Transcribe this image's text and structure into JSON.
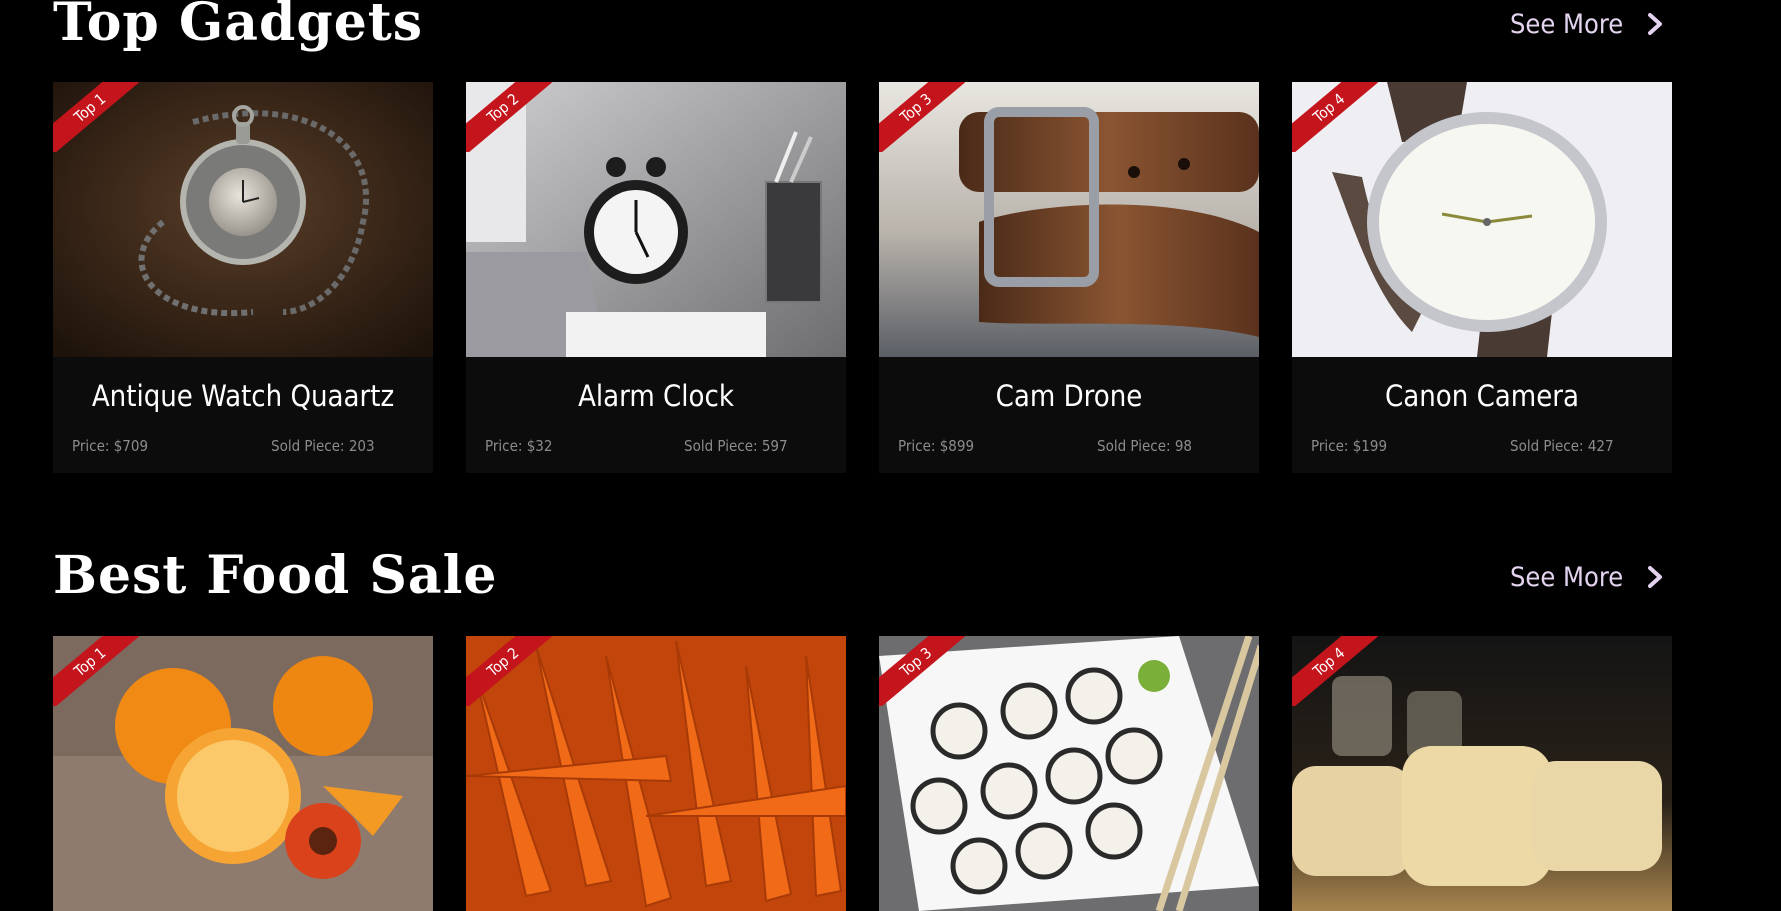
{
  "sections": [
    {
      "title": "Top Gadgets",
      "see_more": "See More",
      "cards": [
        {
          "rank": "Top 1",
          "name": "Antique Watch Quaartz",
          "price": "Price: $709",
          "sold": "Sold Piece: 203",
          "image": "pocket-watch"
        },
        {
          "rank": "Top 2",
          "name": "Alarm Clock",
          "price": "Price: $32",
          "sold": "Sold Piece: 597",
          "image": "alarm-clock"
        },
        {
          "rank": "Top 3",
          "name": "Cam Drone",
          "price": "Price: $899",
          "sold": "Sold Piece: 98",
          "image": "leather-belt"
        },
        {
          "rank": "Top 4",
          "name": "Canon Camera",
          "price": "Price: $199",
          "sold": "Sold Piece: 427",
          "image": "wrist-watch"
        }
      ]
    },
    {
      "title": "Best Food Sale",
      "see_more": "See More",
      "cards": [
        {
          "rank": "Top 1",
          "image": "oranges"
        },
        {
          "rank": "Top 2",
          "image": "carrots"
        },
        {
          "rank": "Top 3",
          "image": "sushi"
        },
        {
          "rank": "Top 4",
          "image": "bread"
        }
      ]
    }
  ],
  "colors": {
    "background": "#000000",
    "ribbon": "#c4141c",
    "see_more": "#e3d3ee",
    "meta_text": "#8c8c8c"
  },
  "icons": {
    "see_more": "chevron-right-icon"
  }
}
